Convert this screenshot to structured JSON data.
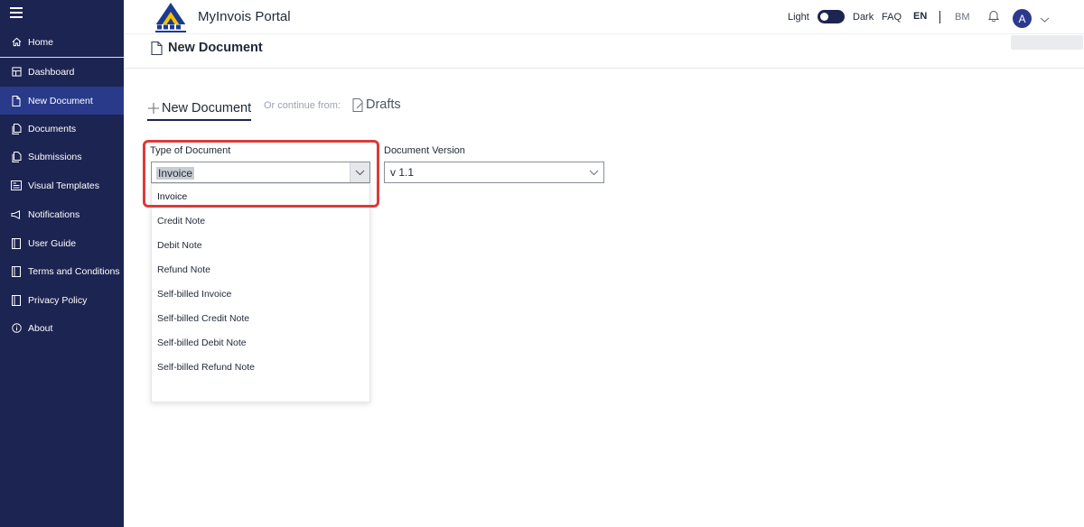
{
  "sidebar": {
    "items": [
      {
        "label": "Home",
        "icon": "home-icon"
      },
      {
        "label": "Dashboard",
        "icon": "dashboard-icon"
      },
      {
        "label": "New Document",
        "icon": "document-icon",
        "active": true
      },
      {
        "label": "Documents",
        "icon": "documents-icon"
      },
      {
        "label": "Submissions",
        "icon": "submissions-icon"
      },
      {
        "label": "Visual Templates",
        "icon": "templates-icon"
      },
      {
        "label": "Notifications",
        "icon": "notifications-icon"
      },
      {
        "label": "User Guide",
        "icon": "book-icon"
      },
      {
        "label": "Terms and Conditions",
        "icon": "book-icon"
      },
      {
        "label": "Privacy Policy",
        "icon": "book-icon"
      },
      {
        "label": "About",
        "icon": "info-icon"
      }
    ]
  },
  "header": {
    "app_title": "MyInvois Portal",
    "theme_light": "Light",
    "theme_dark": "Dark",
    "faq": "FAQ",
    "lang_en": "EN",
    "lang_bm": "BM",
    "avatar_initial": "A"
  },
  "page": {
    "title": "New Document"
  },
  "tabs": {
    "new_document": "New Document",
    "or_continue": "Or continue from:",
    "drafts": "Drafts"
  },
  "form": {
    "type_label": "Type of Document",
    "type_value": "Invoice",
    "version_label": "Document Version",
    "version_value": "v 1.1",
    "type_options": [
      "Invoice",
      "Credit Note",
      "Debit Note",
      "Refund Note",
      "Self-billed Invoice",
      "Self-billed Credit Note",
      "Self-billed Debit Note",
      "Self-billed Refund Note"
    ]
  },
  "colors": {
    "sidebar_bg": "#1c2451",
    "sidebar_active": "#293a8a",
    "highlight": "#dc3a3a"
  }
}
